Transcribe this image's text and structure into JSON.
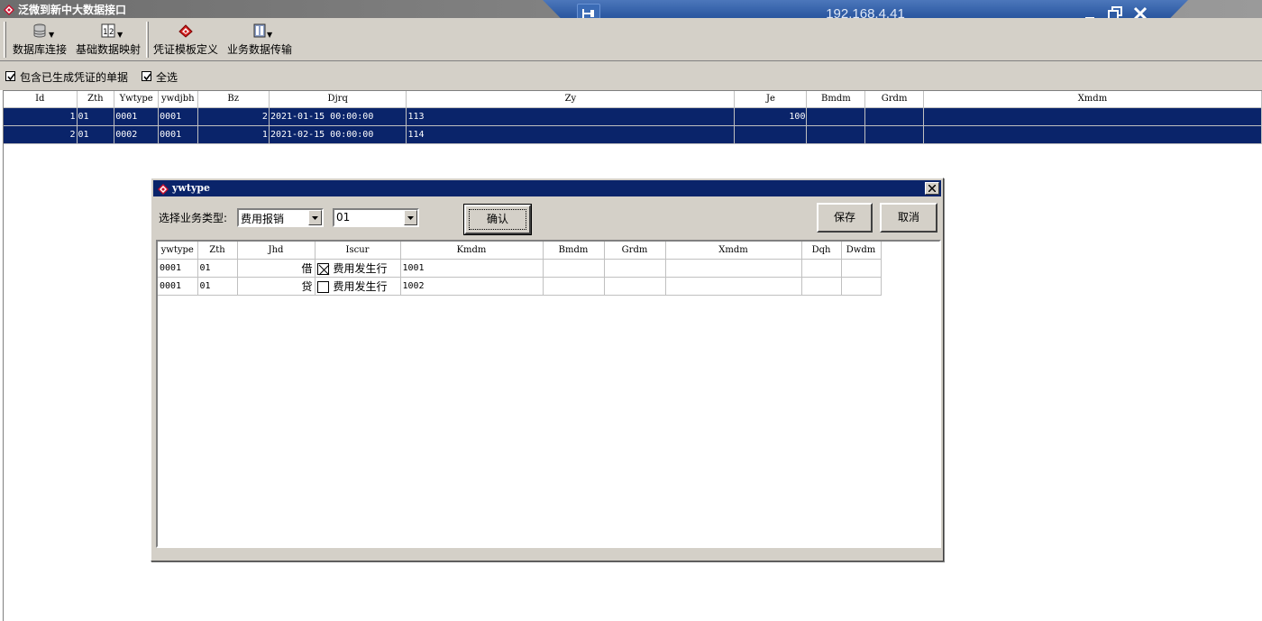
{
  "window": {
    "title": "泛微到新中大数据接口"
  },
  "remote_bar": {
    "host": "192.168.4.41"
  },
  "toolbar": {
    "items": [
      {
        "label": "数据库连接",
        "icon": "database-icon"
      },
      {
        "label": "基础数据映射",
        "icon": "mapping-icon"
      },
      {
        "label": "凭证模板定义",
        "icon": "voucher-template-icon"
      },
      {
        "label": "业务数据传输",
        "icon": "transfer-icon"
      }
    ]
  },
  "filters": {
    "include_generated_label": "包含已生成凭证的单据",
    "include_generated_checked": true,
    "select_all_label": "全选",
    "select_all_checked": true
  },
  "main_grid": {
    "columns": [
      "Id",
      "Zth",
      "Ywtype",
      "ywdjbh",
      "Bz",
      "Djrq",
      "Zy",
      "Je",
      "Bmdm",
      "Grdm",
      "Xmdm"
    ],
    "rows": [
      {
        "id": "1",
        "zth": "01",
        "ywtype": "0001",
        "ywdjbh": "0001",
        "bz": "2",
        "djrq": "2021-01-15 00:00:00",
        "zy": "113",
        "je": "100",
        "bmdm": "",
        "grdm": "",
        "xmdm": ""
      },
      {
        "id": "2",
        "zth": "01",
        "ywtype": "0002",
        "ywdjbh": "0001",
        "bz": "1",
        "djrq": "2021-02-15 00:00:00",
        "zy": "114",
        "je": "",
        "bmdm": "",
        "grdm": "",
        "xmdm": ""
      }
    ]
  },
  "dialog": {
    "title": "ywtype",
    "type_label": "选择业务类型:",
    "type_value": "费用报销",
    "code_value": "01",
    "confirm_label": "确认",
    "save_label": "保存",
    "cancel_label": "取消",
    "grid": {
      "columns": [
        "ywtype",
        "Zth",
        "Jhd",
        "Iscur",
        "Kmdm",
        "Bmdm",
        "Grdm",
        "Xmdm",
        "Dqh",
        "Dwdm"
      ],
      "rows": [
        {
          "ywtype": "0001",
          "zth": "01",
          "jhd": "借",
          "iscur_checked": true,
          "iscur_label": "费用发生行",
          "kmdm": "1001",
          "bmdm": "",
          "grdm": "",
          "xmdm": "",
          "dqh": "",
          "dwdm": ""
        },
        {
          "ywtype": "0001",
          "zth": "01",
          "jhd": "贷",
          "iscur_checked": false,
          "iscur_label": "费用发生行",
          "kmdm": "1002",
          "bmdm": "",
          "grdm": "",
          "xmdm": "",
          "dqh": "",
          "dwdm": ""
        }
      ]
    }
  },
  "colors": {
    "selection": "#0a246a",
    "face": "#d4d0c8",
    "remote_bar": "#2d5aa3"
  }
}
